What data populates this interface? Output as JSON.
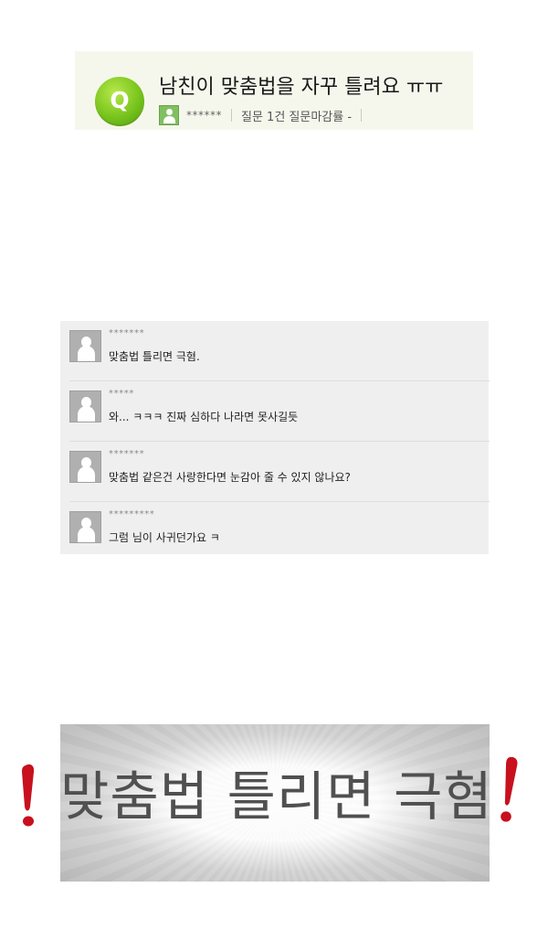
{
  "question": {
    "badge": "Q",
    "title": "남친이 맞춤법을 자꾸 틀려요 ㅠㅠ",
    "user": "******",
    "stat": "질문 1건 질문마감률 -"
  },
  "comments": [
    {
      "user": "*******",
      "text": "맞춤법 틀리면 극혐."
    },
    {
      "user": "*****",
      "text": "와... ㅋㅋㅋ 진짜 심하다 나라면 못사길듯"
    },
    {
      "user": "*******",
      "text": "맞춤법 같은건 사랑한다면 눈감아 줄 수 있지 않나요?"
    },
    {
      "user": "*********",
      "text": "그럼 님이 사귀던가요 ㅋ"
    }
  ],
  "highlight": {
    "text": "맞춤법 틀리면 극혐."
  },
  "colors": {
    "q_badge": "#78c41d",
    "accent_red": "#c8101e"
  },
  "icons": {
    "user_avatar": "user-avatar-icon",
    "exclamation": "exclamation-icon"
  }
}
